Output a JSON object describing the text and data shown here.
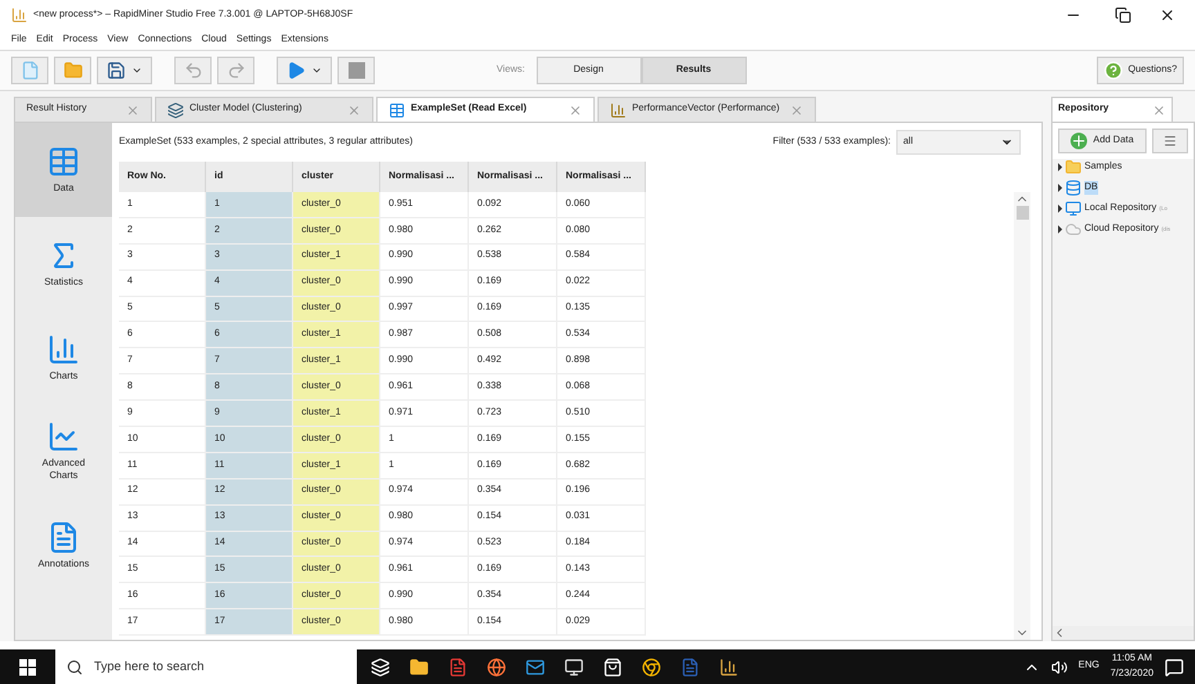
{
  "window": {
    "title": "<new process*> – RapidMiner Studio Free 7.3.001 @ LAPTOP-5H68J0SF"
  },
  "menu": [
    "File",
    "Edit",
    "Process",
    "View",
    "Connections",
    "Cloud",
    "Settings",
    "Extensions"
  ],
  "views": {
    "label": "Views:",
    "items": [
      {
        "label": "Design",
        "selected": false
      },
      {
        "label": "Results",
        "selected": true
      }
    ]
  },
  "help_button": "Questions?",
  "tabs": [
    {
      "label": "Result History",
      "kind": "plain",
      "selected": false
    },
    {
      "label": "Cluster Model (Clustering)",
      "kind": "model",
      "selected": false
    },
    {
      "label": "ExampleSet (Read Excel)",
      "kind": "table",
      "selected": true
    },
    {
      "label": "PerformanceVector (Performance)",
      "kind": "performance",
      "selected": false
    }
  ],
  "sidebar": [
    {
      "label": "Data",
      "kind": "data",
      "selected": true
    },
    {
      "label": "Statistics",
      "kind": "statistics",
      "selected": false
    },
    {
      "label": "Charts",
      "kind": "charts",
      "selected": false
    },
    {
      "label": "Advanced Charts",
      "kind": "advanced",
      "selected": false
    },
    {
      "label": "Annotations",
      "kind": "annotations",
      "selected": false
    }
  ],
  "summary": "ExampleSet (533 examples, 2 special attributes, 3 regular attributes)",
  "filter": {
    "label": "Filter (533 / 533 examples):",
    "value": "all"
  },
  "table": {
    "columns": [
      "Row No.",
      "id",
      "cluster",
      "Normalisasi ...",
      "Normalisasi ...",
      "Normalisasi ..."
    ],
    "rows": [
      [
        "1",
        "1",
        "cluster_0",
        "0.951",
        "0.092",
        "0.060"
      ],
      [
        "2",
        "2",
        "cluster_0",
        "0.980",
        "0.262",
        "0.080"
      ],
      [
        "3",
        "3",
        "cluster_1",
        "0.990",
        "0.538",
        "0.584"
      ],
      [
        "4",
        "4",
        "cluster_0",
        "0.990",
        "0.169",
        "0.022"
      ],
      [
        "5",
        "5",
        "cluster_0",
        "0.997",
        "0.169",
        "0.135"
      ],
      [
        "6",
        "6",
        "cluster_1",
        "0.987",
        "0.508",
        "0.534"
      ],
      [
        "7",
        "7",
        "cluster_1",
        "0.990",
        "0.492",
        "0.898"
      ],
      [
        "8",
        "8",
        "cluster_0",
        "0.961",
        "0.338",
        "0.068"
      ],
      [
        "9",
        "9",
        "cluster_1",
        "0.971",
        "0.723",
        "0.510"
      ],
      [
        "10",
        "10",
        "cluster_0",
        "1",
        "0.169",
        "0.155"
      ],
      [
        "11",
        "11",
        "cluster_1",
        "1",
        "0.169",
        "0.682"
      ],
      [
        "12",
        "12",
        "cluster_0",
        "0.974",
        "0.354",
        "0.196"
      ],
      [
        "13",
        "13",
        "cluster_0",
        "0.980",
        "0.154",
        "0.031"
      ],
      [
        "14",
        "14",
        "cluster_0",
        "0.974",
        "0.523",
        "0.184"
      ],
      [
        "15",
        "15",
        "cluster_0",
        "0.961",
        "0.169",
        "0.143"
      ],
      [
        "16",
        "16",
        "cluster_0",
        "0.990",
        "0.354",
        "0.244"
      ],
      [
        "17",
        "17",
        "cluster_0",
        "0.980",
        "0.154",
        "0.029"
      ]
    ]
  },
  "repository": {
    "title": "Repository",
    "add_button": "Add Data",
    "items": [
      {
        "label": "Samples",
        "kind": "folder",
        "selected": false
      },
      {
        "label": "DB",
        "kind": "db",
        "selected": true
      },
      {
        "label": "Local Repository",
        "kind": "local",
        "selected": false,
        "note": "(Lo"
      },
      {
        "label": "Cloud Repository",
        "kind": "cloud",
        "selected": false,
        "note": "(dis"
      }
    ]
  },
  "taskbar": {
    "search_placeholder": "Type here to search",
    "language": "ENG",
    "time": "11:05 AM",
    "date": "7/23/2020"
  }
}
